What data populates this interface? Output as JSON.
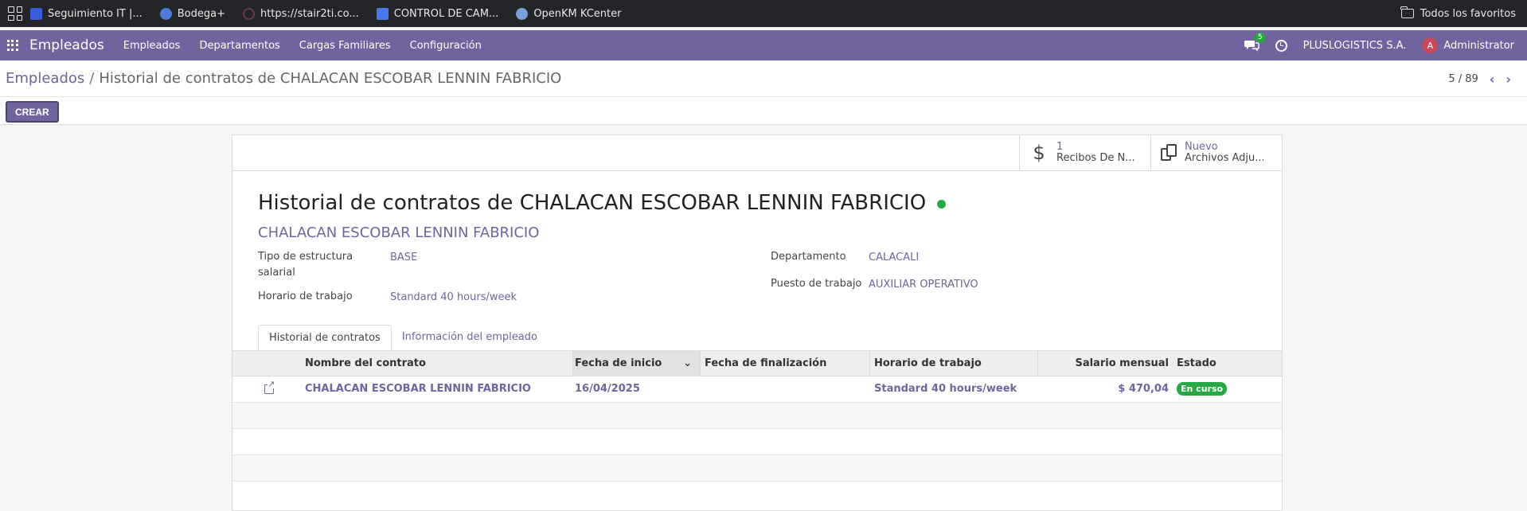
{
  "bookmarks": {
    "items": [
      {
        "label": "Seguimiento IT |...",
        "color": "#3b5bdb"
      },
      {
        "label": "Bodega+",
        "color": "#4f7cd9"
      },
      {
        "label": "https://stair2ti.co...",
        "color": "#5a2e40"
      },
      {
        "label": "CONTROL DE CAM...",
        "color": "#4a78e8"
      },
      {
        "label": "OpenKM KCenter",
        "color": "#7aa0d8"
      }
    ],
    "all_favorites": "Todos los favoritos"
  },
  "navbar": {
    "brand": "Empleados",
    "menu": [
      "Empleados",
      "Departamentos",
      "Cargas Familiares",
      "Configuración"
    ],
    "message_count": "5",
    "company": "PLUSLOGISTICS S.A.",
    "user_initial": "A",
    "user_name": "Administrator",
    "accent": "#71639e"
  },
  "control_panel": {
    "breadcrumb_root": "Empleados",
    "breadcrumb_separator": "/",
    "breadcrumb_current": "Historial de contratos de CHALACAN ESCOBAR LENNIN FABRICIO",
    "pager": "5 / 89",
    "create_label": "CREAR"
  },
  "stat_buttons": [
    {
      "value": "1",
      "label": "Recibos De N...",
      "icon": "dollar-icon"
    },
    {
      "value": "Nuevo",
      "label": "Archivos Adju...",
      "icon": "documents-icon"
    }
  ],
  "form": {
    "title": "Historial de contratos de CHALACAN ESCOBAR LENNIN FABRICIO",
    "employee": "CHALACAN ESCOBAR LENNIN FABRICIO",
    "fields_left": [
      {
        "label": "Tipo de estructura salarial",
        "value": "BASE"
      },
      {
        "label": "Horario de trabajo",
        "value": "Standard 40 hours/week"
      }
    ],
    "fields_right": [
      {
        "label": "Departamento",
        "value": "CALACALI"
      },
      {
        "label": "Puesto de trabajo",
        "value": "AUXILIAR OPERATIVO"
      }
    ],
    "status_color": "#28a745"
  },
  "tabs": [
    "Historial de contratos",
    "Información del empleado"
  ],
  "table": {
    "columns": [
      "Nombre del contrato",
      "Fecha de inicio",
      "Fecha de finalización",
      "Horario de trabajo",
      "Salario mensual",
      "Estado"
    ],
    "rows": [
      {
        "name": "CHALACAN ESCOBAR LENNIN FABRICIO",
        "start": "16/04/2025",
        "end": "",
        "schedule": "Standard 40 hours/week",
        "salary": "$ 470,04",
        "state": "En curso"
      }
    ]
  }
}
